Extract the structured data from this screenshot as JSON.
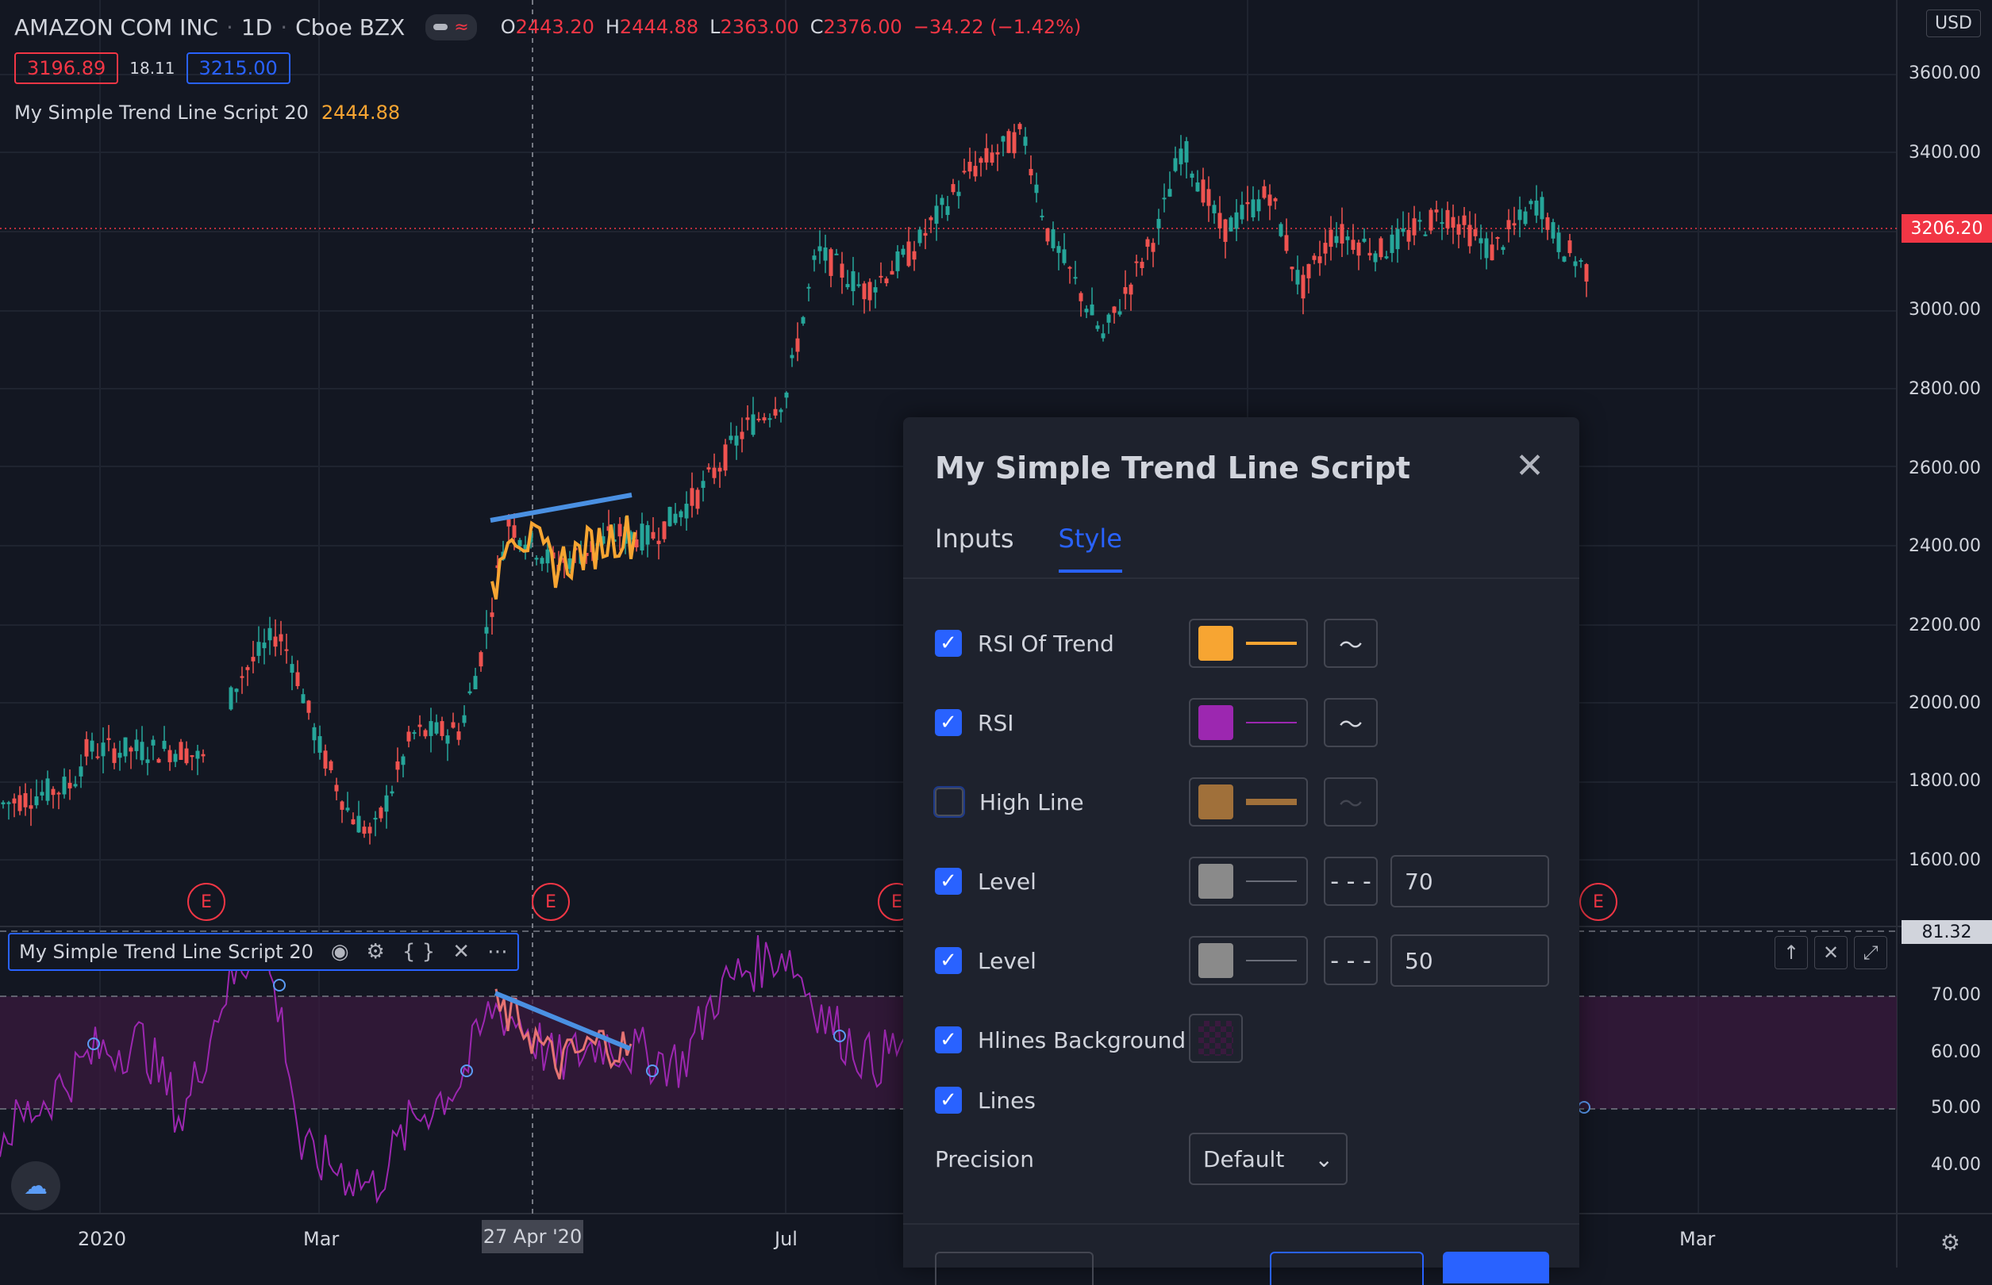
{
  "header": {
    "symbol": "AMAZON COM INC",
    "interval": "1D",
    "exchange": "Cboe BZX",
    "ohlc": {
      "o_label": "O",
      "o": "2443.20",
      "h_label": "H",
      "h": "2444.88",
      "l_label": "L",
      "l": "2363.00",
      "c_label": "C",
      "c": "2376.00",
      "change": "−34.22 (−1.42%)"
    },
    "bid": "3196.89",
    "spread": "18.11",
    "ask": "3215.00",
    "indicator_name": "My Simple Trend Line Script 20",
    "indicator_value": "2444.88",
    "currency": "USD"
  },
  "price_axis": [
    "3600.00",
    "3400.00",
    "3206.20",
    "3000.00",
    "2800.00",
    "2600.00",
    "2400.00",
    "2200.00",
    "2000.00",
    "1800.00",
    "1600.00"
  ],
  "current_price": "3206.20",
  "rsi_axis": [
    "70.00",
    "60.00",
    "50.00",
    "40.00"
  ],
  "rsi_current": "81.32",
  "time_axis": {
    "labels": [
      "2020",
      "Mar",
      "Jul",
      "Mar"
    ],
    "cursor": "27 Apr '20"
  },
  "earnings_marker": "E",
  "indicator_pane": {
    "legend": "My Simple Trend Line Script 20",
    "icons": [
      "eye-icon",
      "gear-icon",
      "braces-icon",
      "close-icon",
      "more-icon"
    ]
  },
  "pane_controls": [
    "↑",
    "✕",
    "⤢"
  ],
  "dialog": {
    "title": "My Simple Trend Line Script",
    "tabs": [
      "Inputs",
      "Style"
    ],
    "active_tab": "Style",
    "rows": [
      {
        "label": "RSI Of Trend",
        "checked": true,
        "color": "#f7a532"
      },
      {
        "label": "RSI",
        "checked": true,
        "color": "#9c27b0"
      },
      {
        "label": "High Line",
        "checked": false,
        "color": "#a0703a"
      },
      {
        "label": "Level",
        "checked": true,
        "color": "#8a8a8a",
        "value": "70"
      },
      {
        "label": "Level",
        "checked": true,
        "color": "#8a8a8a",
        "value": "50"
      },
      {
        "label": "Hlines Background",
        "checked": true
      },
      {
        "label": "Lines",
        "checked": true
      }
    ],
    "precision_label": "Precision",
    "precision_value": "Default"
  },
  "colors": {
    "bg": "#131722",
    "up": "#26a69a",
    "down": "#ef5350",
    "accent": "#2962ff",
    "trend": "#f7a532",
    "rsi": "#9c27b0",
    "trendline": "#4a90e2"
  }
}
